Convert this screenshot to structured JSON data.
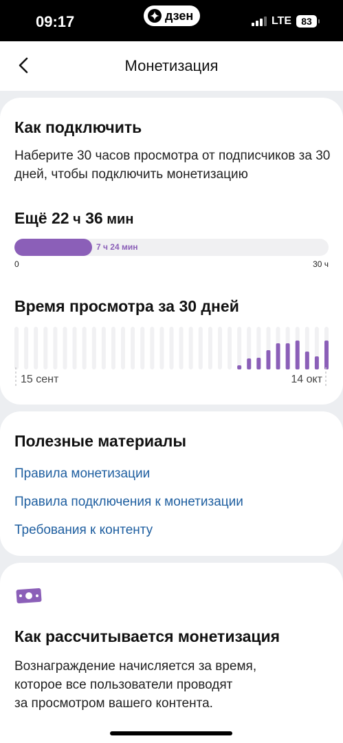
{
  "status_bar": {
    "time": "09:17",
    "app_badge": "дзен",
    "network": "LTE",
    "battery": "83"
  },
  "nav": {
    "title": "Монетизация",
    "back_icon": "chevron-left-icon"
  },
  "connect": {
    "heading": "Как подключить",
    "description": "Наберите 30 часов просмотра от подписчиков за 30 дней, чтобы подключить монетизацию",
    "remaining_prefix": "Ещё",
    "remaining_hours": "22",
    "hours_unit": "ч",
    "remaining_minutes": "36",
    "minutes_unit": "мин",
    "progress": {
      "value_label": "7 ч 24 мин",
      "fraction": 0.2467,
      "min_label": "0",
      "max_label": "30 ч"
    }
  },
  "watch_time": {
    "heading": "Время просмотра за 30 дней",
    "start_label": "15 сент",
    "end_label": "14 окт",
    "accent_color": "#8b5fb8",
    "bar_levels": [
      0,
      0,
      0,
      0,
      0,
      0,
      0,
      0,
      0,
      0,
      0,
      0,
      0,
      0,
      0,
      0,
      0,
      0,
      0,
      0,
      0,
      0,
      0,
      0.1,
      0.25,
      0.28,
      0.45,
      0.62,
      0.62,
      0.68,
      0.42,
      0.3,
      0.68
    ]
  },
  "useful": {
    "heading": "Полезные материалы",
    "links": [
      "Правила монетизации",
      "Правила подключения к монетизации",
      "Требования к контенту"
    ]
  },
  "calc": {
    "icon": "money-icon",
    "heading": "Как рассчитывается монетизация",
    "description_lines": [
      "Вознаграждение начисляется за время,",
      "которое все пользователи проводят",
      "за просмотром вашего контента."
    ]
  }
}
